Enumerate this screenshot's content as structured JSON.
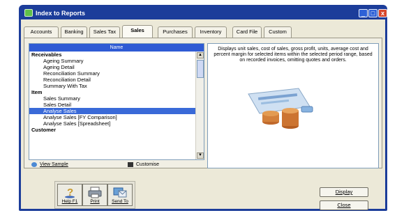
{
  "window": {
    "title": "Index to Reports",
    "minimize_label": "_",
    "maximize_label": "□",
    "close_label": "x"
  },
  "tabs": [
    {
      "label": "Accounts"
    },
    {
      "label": "Banking"
    },
    {
      "label": "Sales Tax"
    },
    {
      "label": "Sales",
      "active": true
    },
    {
      "label": "Purchases"
    },
    {
      "label": "Inventory"
    },
    {
      "label": "Card File"
    },
    {
      "label": "Custom"
    }
  ],
  "report_list": {
    "header": "Name",
    "items": [
      {
        "label": "Receivables",
        "kind": "header"
      },
      {
        "label": "Ageing Summary",
        "kind": "item"
      },
      {
        "label": "Ageing Detail",
        "kind": "item"
      },
      {
        "label": "Reconciliation Summary",
        "kind": "item"
      },
      {
        "label": "Reconciliation Detail",
        "kind": "item"
      },
      {
        "label": "Summary With Tax",
        "kind": "item"
      },
      {
        "label": "Item",
        "kind": "header"
      },
      {
        "label": "Sales Summary",
        "kind": "item"
      },
      {
        "label": "Sales Detail",
        "kind": "item"
      },
      {
        "label": "Analyse Sales",
        "kind": "item",
        "selected": true
      },
      {
        "label": "Analyse Sales [FY Comparison]",
        "kind": "item"
      },
      {
        "label": "Analyse Sales [Spreadsheet]",
        "kind": "item"
      },
      {
        "label": "Customer",
        "kind": "header"
      }
    ],
    "scroll_up": "▲",
    "scroll_down": "▼"
  },
  "list_buttons": {
    "view_sample": "View Sample",
    "customize": "Customise"
  },
  "description": "Displays unit sales, cost of sales, gross profit, units, average cost and percent margin for selected items within the selected period range, based on recorded invoices, omitting quotes and orders.",
  "toolbar": {
    "help": "Help F1",
    "print": "Print",
    "send_to": "Send To"
  },
  "actions": {
    "display": "Display",
    "close": "Close"
  },
  "colors": {
    "title_bar": "#1c3d9a",
    "selection": "#3a6ad8",
    "list_header": "#2f5bd4"
  }
}
